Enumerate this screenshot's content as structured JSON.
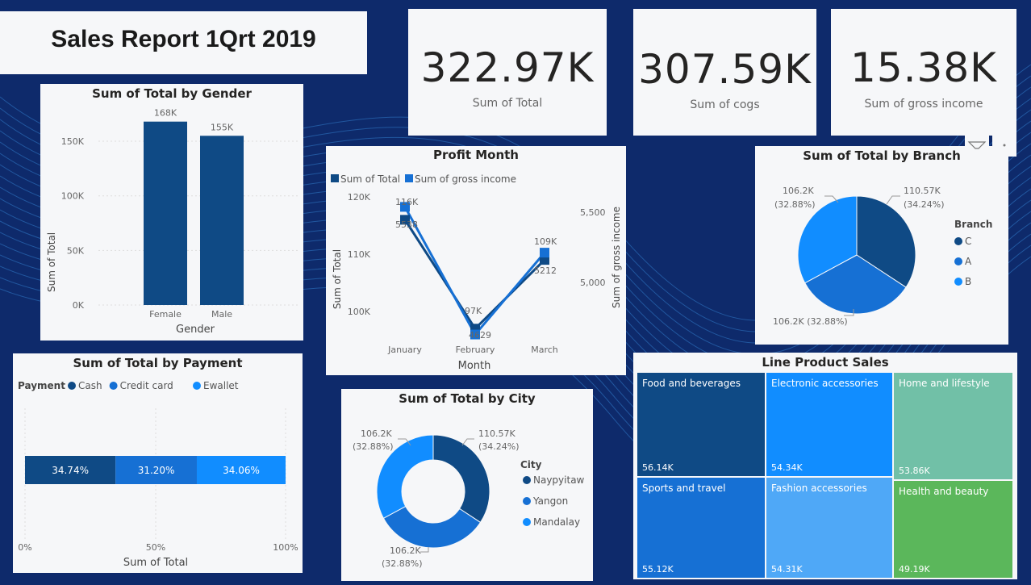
{
  "report": {
    "title": "Sales Report 1Qrt 2019"
  },
  "kpis": [
    {
      "value": "322.97K",
      "label": "Sum of Total"
    },
    {
      "value": "307.59K",
      "label": "Sum of cogs"
    },
    {
      "value": "15.38K",
      "label": "Sum of gross income"
    }
  ],
  "colors": {
    "background": "#0e2a6b",
    "dark_blue": "#0f4a85",
    "mid_blue": "#1670d4",
    "light_blue": "#118dff",
    "teal": "#71c0a7",
    "green": "#5bb75b",
    "sky": "#4fa8f7"
  },
  "gender_chart": {
    "title": "Sum of Total by Gender",
    "xlabel": "Gender",
    "ylabel": "Sum of Total",
    "ticks": [
      "0K",
      "50K",
      "100K",
      "150K"
    ],
    "chart_data": {
      "type": "bar",
      "categories": [
        "Female",
        "Male"
      ],
      "values": [
        168,
        155
      ],
      "value_labels": [
        "168K",
        "155K"
      ],
      "ylim": [
        0,
        170
      ]
    }
  },
  "profit_chart": {
    "title": "Profit Month",
    "xlabel": "Month",
    "ylabel_left": "Sum of Total",
    "ylabel_right": "Sum of gross income",
    "legend": [
      "Sum of Total",
      "Sum of gross income"
    ],
    "left_ticks": [
      "100K",
      "110K",
      "120K"
    ],
    "right_ticks": [
      "5,000",
      "5,500"
    ],
    "chart_data": {
      "type": "line",
      "categories": [
        "January",
        "February",
        "March"
      ],
      "series": [
        {
          "name": "Sum of Total",
          "values": [
            116,
            97,
            109
          ],
          "labels": [
            "116K",
            "97K",
            "109K"
          ]
        },
        {
          "name": "Sum of gross income",
          "values": [
            5538,
            4629,
            5212
          ],
          "labels": [
            "5538",
            "4629",
            "5212"
          ]
        }
      ]
    }
  },
  "branch_chart": {
    "title": "Sum of Total by Branch",
    "legend_title": "Branch",
    "chart_data": {
      "type": "pie",
      "categories": [
        "C",
        "A",
        "B"
      ],
      "values": [
        34.24,
        32.88,
        32.88
      ],
      "labels": [
        "110.57K (34.24%)",
        "106.2K (32.88%)",
        "106.2K (32.88%)"
      ]
    }
  },
  "payment_chart": {
    "title": "Sum of Total by Payment",
    "legend_title": "Payment",
    "xlabel": "Sum of Total",
    "ticks": [
      "0%",
      "50%",
      "100%"
    ],
    "chart_data": {
      "type": "bar",
      "categories": [
        "Cash",
        "Credit card",
        "Ewallet"
      ],
      "values": [
        34.74,
        31.2,
        34.06
      ],
      "labels": [
        "34.74%",
        "31.20%",
        "34.06%"
      ]
    }
  },
  "city_chart": {
    "title": "Sum of Total by City",
    "legend_title": "City",
    "chart_data": {
      "type": "pie",
      "categories": [
        "Naypyitaw",
        "Yangon",
        "Mandalay"
      ],
      "values": [
        34.24,
        32.88,
        32.88
      ],
      "labels": [
        "110.57K (34.24%)",
        "106.2K (32.88%)",
        "106.2K (32.88%)"
      ]
    }
  },
  "treemap": {
    "title": "Line Product Sales",
    "cells": [
      {
        "label": "Food and beverages",
        "value": "56.14K"
      },
      {
        "label": "Electronic accessories",
        "value": "54.34K"
      },
      {
        "label": "Home and lifestyle",
        "value": "53.86K"
      },
      {
        "label": "Sports and travel",
        "value": "55.12K"
      },
      {
        "label": "Fashion accessories",
        "value": "54.31K"
      },
      {
        "label": "Health and beauty",
        "value": "49.19K"
      }
    ]
  }
}
